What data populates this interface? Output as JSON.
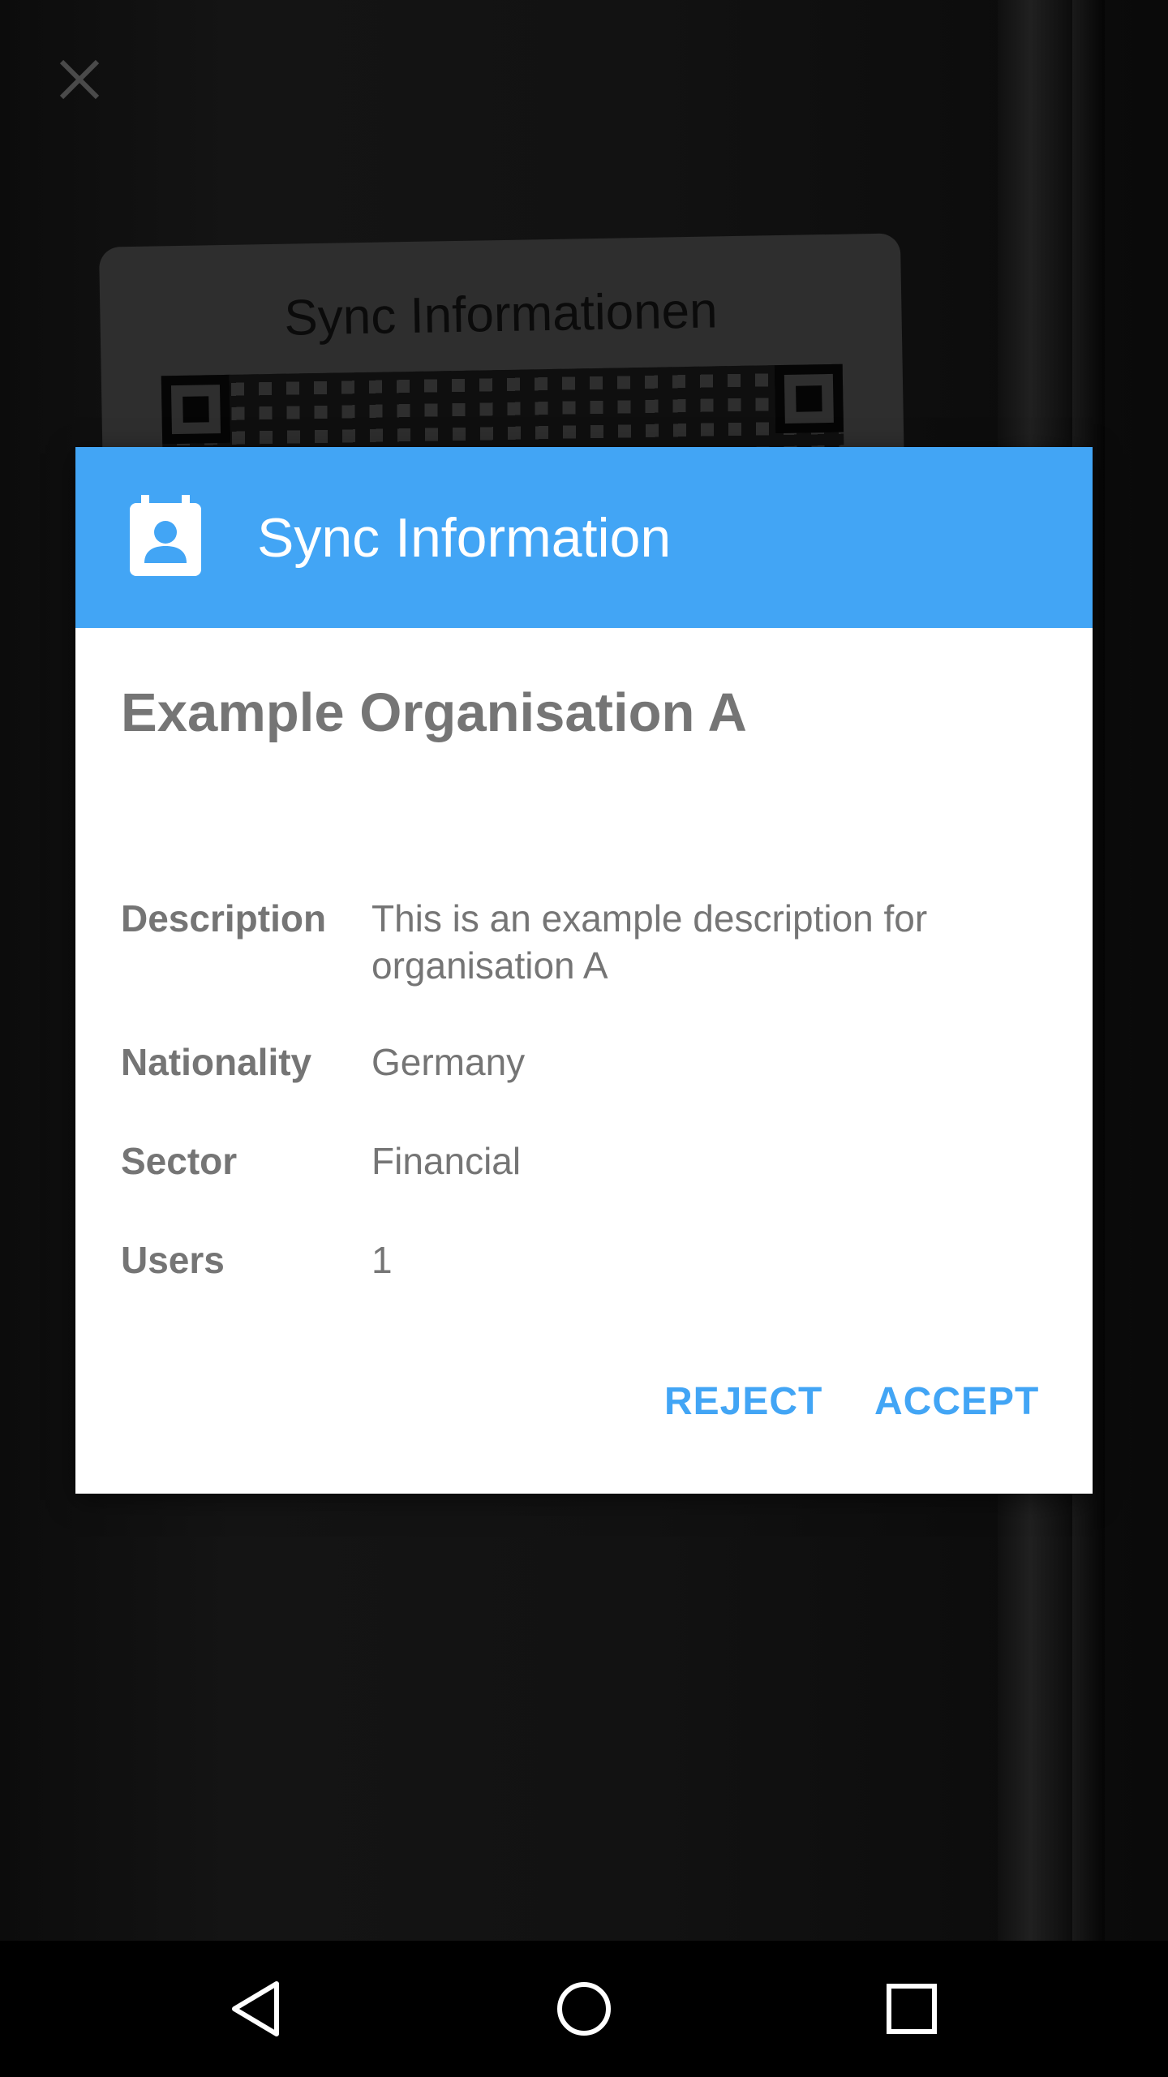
{
  "camera": {
    "card_title": "Sync Informationen"
  },
  "dialog": {
    "title": "Sync Information",
    "organisation_name": "Example Organisation A",
    "fields": [
      {
        "label": "Description",
        "value": "This is an example description for organisation A"
      },
      {
        "label": "Nationality",
        "value": "Germany"
      },
      {
        "label": "Sector",
        "value": "Financial"
      },
      {
        "label": "Users",
        "value": "1"
      }
    ],
    "reject_label": "REJECT",
    "accept_label": "ACCEPT"
  },
  "colors": {
    "accent": "#42a5f5",
    "text_secondary": "#757575",
    "dialog_background": "#ffffff",
    "screen_background": "#000000"
  },
  "icons": {
    "close": "close-icon",
    "header": "contact-calendar-icon",
    "nav_back": "back-triangle-icon",
    "nav_home": "home-circle-icon",
    "nav_recents": "recents-square-icon"
  }
}
